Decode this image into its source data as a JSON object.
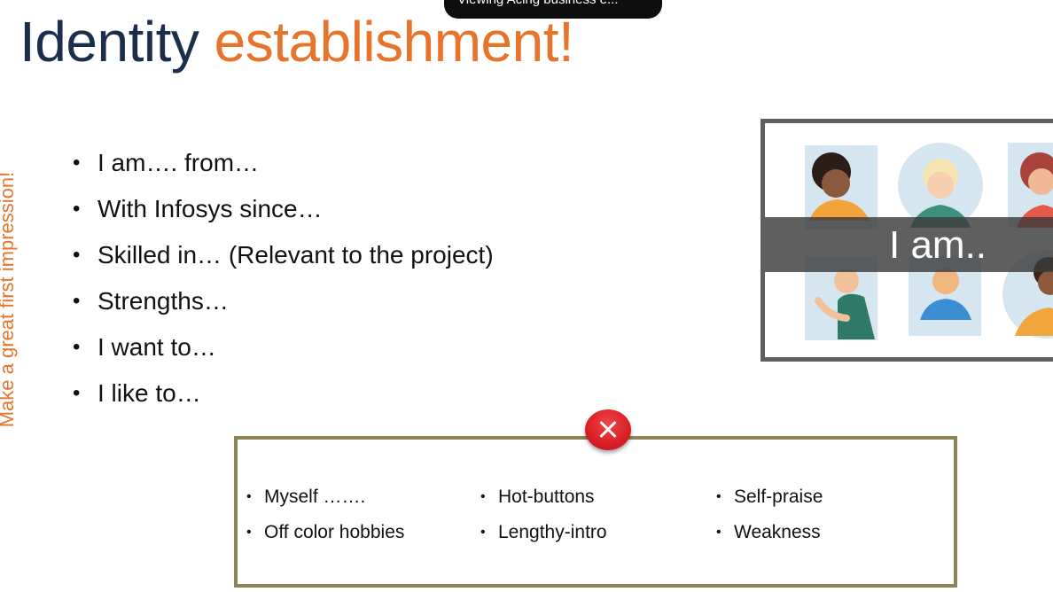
{
  "slide": {
    "title_part1": "Identity",
    "title_part2": "establishment!",
    "side_text": "Make a great first impression!",
    "bullets": [
      "I am….   from…",
      "With Infosys since…",
      "Skilled in… (Relevant to the project)",
      "Strengths…",
      "I want to…",
      "I like to…"
    ],
    "image_caption": "I am..",
    "avoid_items": [
      [
        "Myself …….",
        "Hot-buttons",
        "Self-praise"
      ],
      [
        "Off color hobbies",
        "Lengthy-intro",
        "Weakness"
      ]
    ]
  },
  "overlay": {
    "viewing_label": "Viewing Acing business e...",
    "chevron_icon": "chevron-down-icon"
  },
  "colors": {
    "title_dark": "#1c2e4a",
    "accent_orange": "#e8732a",
    "box_border": "#8c8558",
    "badge_red": "#d91f26"
  }
}
